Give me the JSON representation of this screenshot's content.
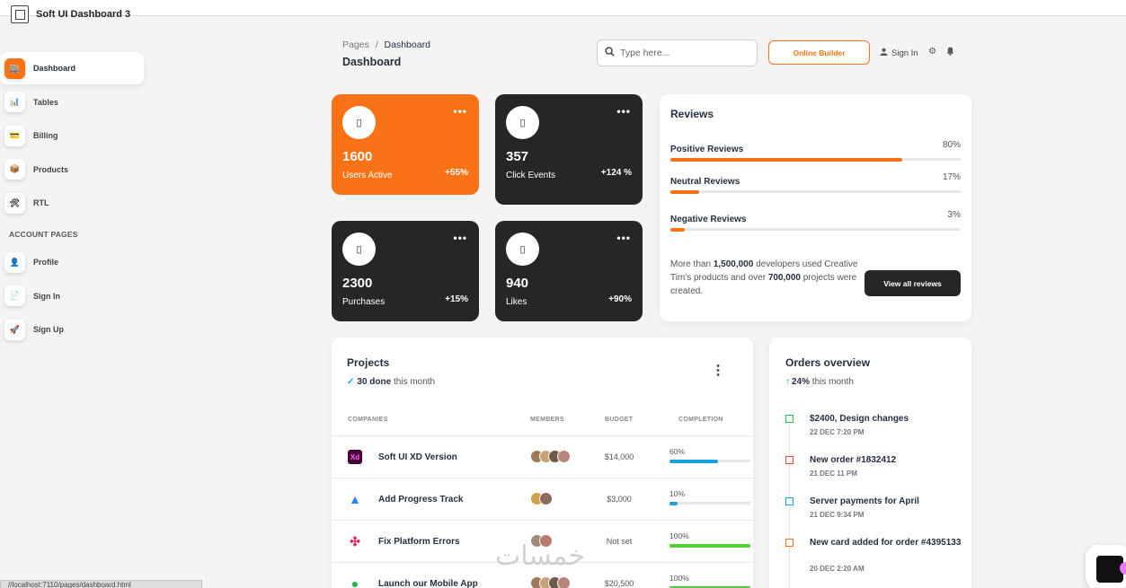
{
  "app": {
    "title": "Soft UI Dashboard 3"
  },
  "sidebar": {
    "items": [
      {
        "label": "Dashboard",
        "icon": "shop-icon",
        "glyph": "🏬"
      },
      {
        "label": "Tables",
        "icon": "chart-icon",
        "glyph": "📊"
      },
      {
        "label": "Billing",
        "icon": "credit-card-icon",
        "glyph": "💳"
      },
      {
        "label": "Products",
        "icon": "box-icon",
        "glyph": "📦"
      },
      {
        "label": "RTL",
        "icon": "tools-icon",
        "glyph": "🛠"
      }
    ],
    "section_title": "ACCOUNT PAGES",
    "account_items": [
      {
        "label": "Profile",
        "icon": "user-icon",
        "glyph": "👤"
      },
      {
        "label": "Sign In",
        "icon": "document-icon",
        "glyph": "📄"
      },
      {
        "label": "Sign Up",
        "icon": "rocket-icon",
        "glyph": "🚀"
      }
    ]
  },
  "header": {
    "breadcrumb": {
      "root": "Pages",
      "separator": "/",
      "current": "Dashboard"
    },
    "title": "Dashboard",
    "search_placeholder": "Type here...",
    "builder_button": "Online Builder",
    "signin_label": "Sign In"
  },
  "stats": [
    {
      "value": "1600",
      "label": "Users Active",
      "change": "+55%"
    },
    {
      "value": "357",
      "label": "Click Events",
      "change": "+124 %"
    },
    {
      "value": "2300",
      "label": "Purchases",
      "change": "+15%"
    },
    {
      "value": "940",
      "label": "Likes",
      "change": "+90%"
    }
  ],
  "reviews": {
    "title": "Reviews",
    "rows": [
      {
        "label": "Positive Reviews",
        "pct": "80%",
        "value": 80
      },
      {
        "label": "Neutral Reviews",
        "pct": "17%",
        "value": 17
      },
      {
        "label": "Negative Reviews",
        "pct": "3%",
        "value": 3
      }
    ],
    "text_parts": [
      "More than ",
      "1,500,000",
      " developers used Creative Tim's products and over ",
      "700,000",
      " projects were created."
    ],
    "button": "View all reviews"
  },
  "projects": {
    "title": "Projects",
    "done": "30 done",
    "done_suffix": " this month",
    "headers": {
      "companies": "COMPANIES",
      "members": "MEMBERS",
      "budget": "BUDGET",
      "completion": "COMPLETION"
    },
    "rows": [
      {
        "name": "Soft UI XD Version",
        "logo": "Xd",
        "budget": "$14,000",
        "completion": "60%",
        "value": 60,
        "color": "#17a2e0",
        "members": 4
      },
      {
        "name": "Add Progress Track",
        "logo": "▲",
        "budget": "$3,000",
        "completion": "10%",
        "value": 10,
        "color": "#17a2e0",
        "members": 2
      },
      {
        "name": "Fix Platform Errors",
        "logo": "✣",
        "budget": "Not set",
        "completion": "100%",
        "value": 100,
        "color": "#4cd137",
        "members": 2
      },
      {
        "name": "Launch our Mobile App",
        "logo": "●",
        "budget": "$20,500",
        "completion": "100%",
        "value": 100,
        "color": "#4cd137",
        "members": 4
      }
    ]
  },
  "orders": {
    "title": "Orders overview",
    "growth": "24%",
    "growth_suffix": " this month",
    "items": [
      {
        "text": "$2400, Design changes",
        "date": "22 DEC 7:20 PM",
        "color": "#22c55e"
      },
      {
        "text": "New order #1832412",
        "date": "21 DEC 11 PM",
        "color": "#ef4444"
      },
      {
        "text": "Server payments for April",
        "date": "21 DEC 9:34 PM",
        "color": "#0ea5e9"
      },
      {
        "text": "New card added for order #4395133",
        "date": "20 DEC 2:20 AM",
        "color": "#f97316"
      }
    ]
  },
  "statusbar": {
    "url": "//localhost:7110/pages/dashboard.html"
  },
  "watermark": "خمسات",
  "colors": {
    "accent": "#f97316",
    "dark": "#262626"
  }
}
